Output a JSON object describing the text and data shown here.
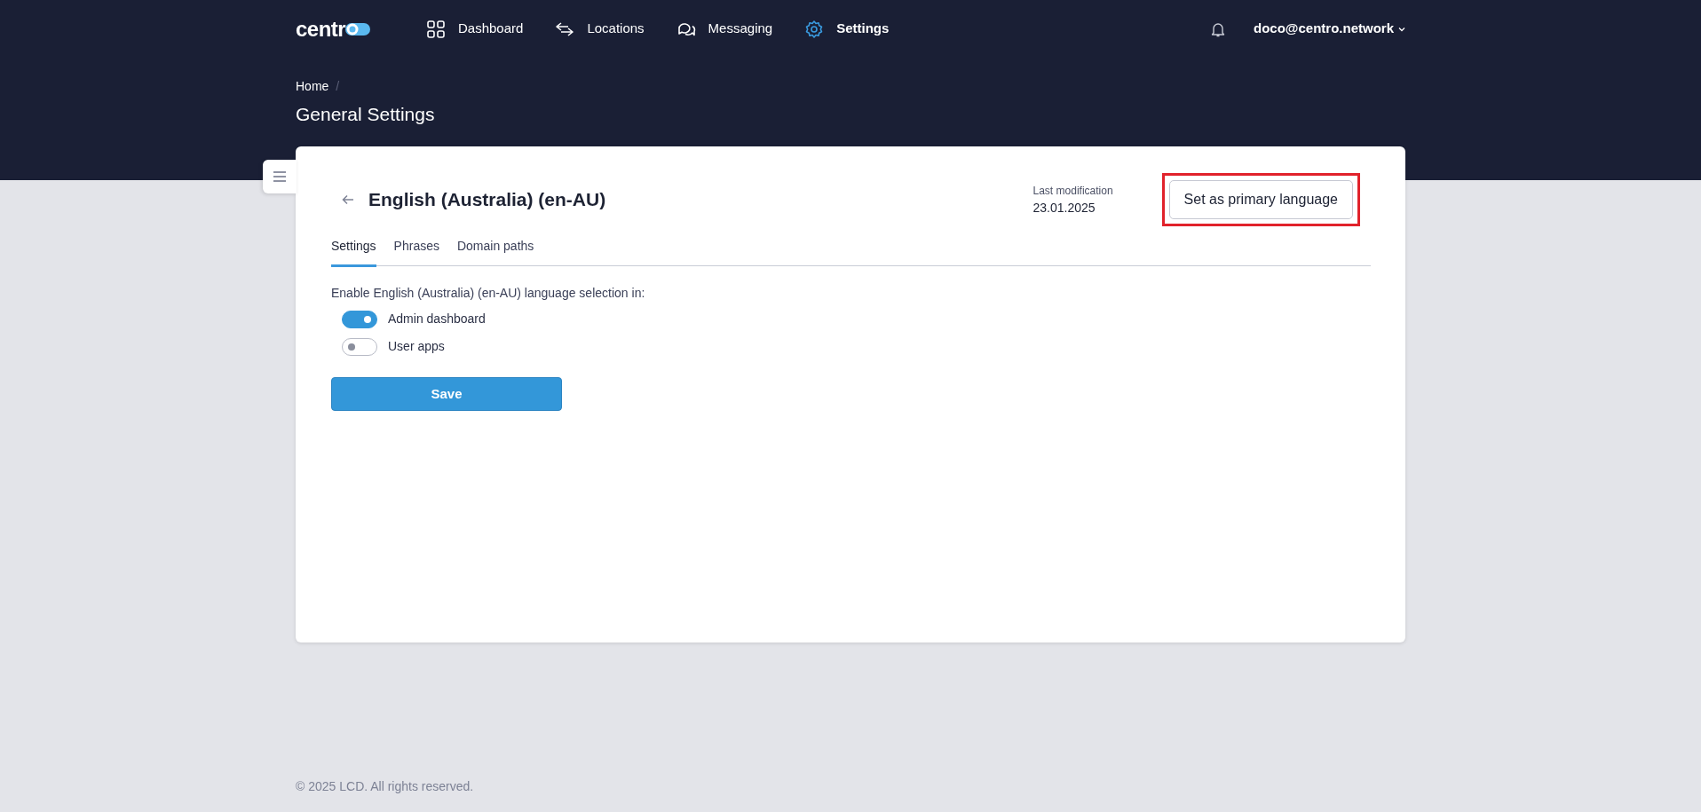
{
  "logo": {
    "text": "centr"
  },
  "nav": [
    {
      "label": "Dashboard",
      "selected": false
    },
    {
      "label": "Locations",
      "selected": false
    },
    {
      "label": "Messaging",
      "selected": false
    },
    {
      "label": "Settings",
      "selected": true
    }
  ],
  "user": {
    "email": "doco@centro.network"
  },
  "breadcrumb": {
    "items": [
      "Home"
    ],
    "separator": "/"
  },
  "page_title": "General Settings",
  "language": {
    "title": "English (Australia) (en-AU)",
    "last_modification_label": "Last modification",
    "last_modification": "23.01.2025",
    "primary_button": {
      "label": "Set as primary language",
      "highlighted": true
    }
  },
  "tabs": [
    {
      "label": "Settings",
      "selected": true
    },
    {
      "label": "Phrases",
      "selected": false
    },
    {
      "label": "Domain paths",
      "selected": false
    }
  ],
  "enable_label": "Enable English (Australia) (en-AU) language selection in:",
  "toggles": [
    {
      "label": "Admin dashboard",
      "on": true
    },
    {
      "label": "User apps",
      "on": false
    }
  ],
  "save_button": "Save",
  "footer": "© 2025 LCD. All rights reserved."
}
